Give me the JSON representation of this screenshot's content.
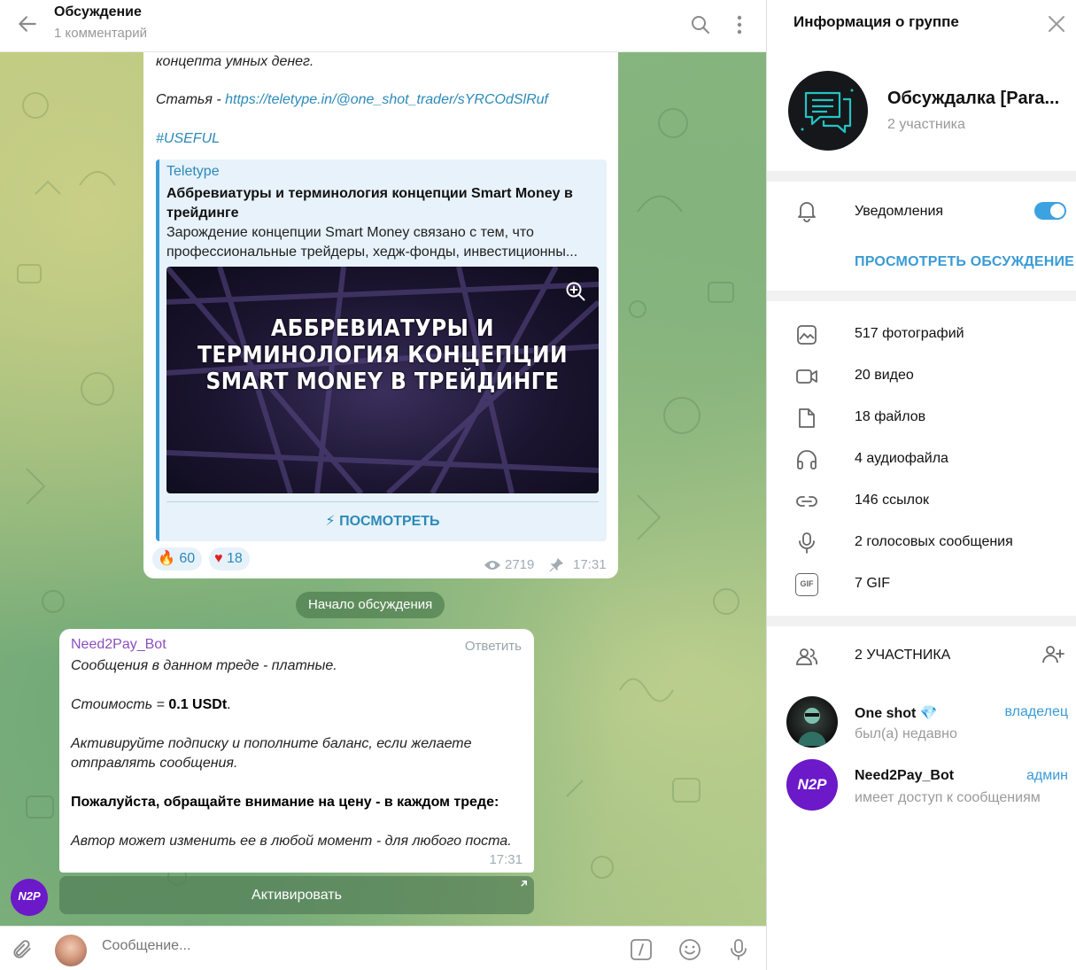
{
  "chat": {
    "title": "Обсуждение",
    "subtitle": "1 комментарий",
    "post": {
      "line1": "концепта умных денег.",
      "article_prefix": "Статья - ",
      "article_link": "https://teletype.in/@one_shot_trader/sYRCOdSlRuf",
      "hashtag": "#USEFUL",
      "preview_site": "Teletype",
      "preview_title": "Аббревиатуры и терминология концепции Smart Money в трейдинге",
      "preview_desc_1": "Зарождение концепции Smart Money связано с тем, что",
      "preview_desc_2": "профессиональные трейдеры, хедж-фонды, инвестиционны...",
      "image_text_1": "АББРЕВИАТУРЫ И",
      "image_text_2": "ТЕРМИНОЛОГИЯ КОНЦЕПЦИИ",
      "image_text_3": "SMART MONEY В ТРЕЙДИНГЕ",
      "view_button": "⚡ ПОСМОТРЕТЬ",
      "reaction_fire_count": "60",
      "reaction_heart_count": "18",
      "views": "2719",
      "time": "17:31"
    },
    "service_label": "Начало обсуждения",
    "bot_message": {
      "author": "Need2Pay_Bot",
      "reply_label": "Ответить",
      "line1": "Сообщения в данном треде - платные.",
      "price_prefix": "Стоимость = ",
      "price_value": "0.1 USDt",
      "price_suffix": ".",
      "line3a": "Активируйте подписку и пополните баланс, если желаете",
      "line3b": "отправлять сообщения.",
      "line4": "Пожалуйста, обращайте внимание на цену - в каждом треде:",
      "line5": "Автор может изменить ее в любой момент - для любого поста.",
      "time": "17:31",
      "activate_button": "Активировать",
      "avatar_text": "N2P"
    },
    "composer_placeholder": "Сообщение..."
  },
  "info": {
    "title": "Информация о группе",
    "group_name": "Обсуждалка [Para...",
    "group_members": "2 участника",
    "notifications_label": "Уведомления",
    "view_discussion": "ПРОСМОТРЕТЬ ОБСУЖДЕНИЕ",
    "media": [
      {
        "label": "517 фотографий",
        "icon": "photo-icon"
      },
      {
        "label": "20 видео",
        "icon": "video-icon"
      },
      {
        "label": "18 файлов",
        "icon": "file-icon"
      },
      {
        "label": "4 аудиофайла",
        "icon": "headphones-icon"
      },
      {
        "label": "146 ссылок",
        "icon": "link-icon"
      },
      {
        "label": "2 голосовых сообщения",
        "icon": "mic-icon"
      },
      {
        "label": "7 GIF",
        "icon": "gif-icon"
      }
    ],
    "members_header": "2 УЧАСТНИКА",
    "members": [
      {
        "name": "One shot",
        "status": "был(а) недавно",
        "role": "владелец"
      },
      {
        "name": "Need2Pay_Bot",
        "status": "имеет доступ к сообщениям",
        "role": "админ",
        "avatar_text": "N2P"
      }
    ],
    "gif_badge": "GIF"
  },
  "colors": {
    "accent": "#3a9bd5",
    "bot_name": "#8b4fc1",
    "bot_avatar": "#6b19c9"
  }
}
